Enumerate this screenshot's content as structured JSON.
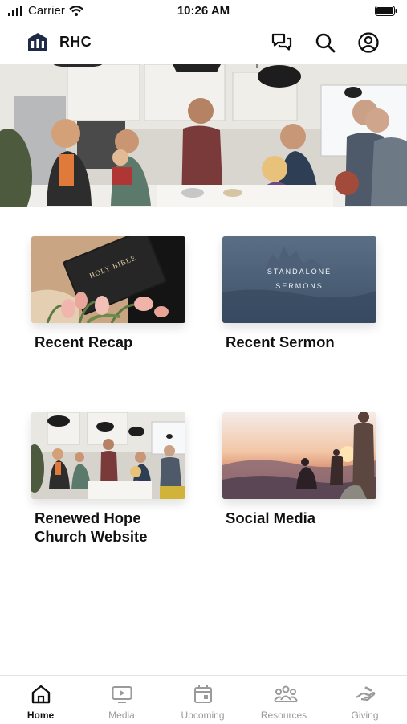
{
  "status_bar": {
    "carrier": "Carrier",
    "time": "10:26 AM"
  },
  "header": {
    "title": "RHC",
    "logo_icon": "church-logo-icon",
    "actions": [
      "chat-icon",
      "search-icon",
      "account-icon"
    ]
  },
  "cards": [
    {
      "label": "Recent Recap"
    },
    {
      "label": "Recent Sermon",
      "thumb_text": [
        "STANDALONE",
        "SERMONS"
      ]
    },
    {
      "label": "Renewed Hope Church Website"
    },
    {
      "label": "Social Media"
    }
  ],
  "bible_text": "HOLY BIBLE",
  "tabs": [
    {
      "label": "Home",
      "icon": "home-icon",
      "active": true
    },
    {
      "label": "Media",
      "icon": "media-play-icon"
    },
    {
      "label": "Upcoming",
      "icon": "calendar-icon"
    },
    {
      "label": "Resources",
      "icon": "people-icon"
    },
    {
      "label": "Giving",
      "icon": "giving-hand-icon"
    }
  ],
  "colors": {
    "active_tab": "#111111",
    "inactive_tab": "#9a9a9a",
    "brand_icon": "#1f2a44"
  }
}
